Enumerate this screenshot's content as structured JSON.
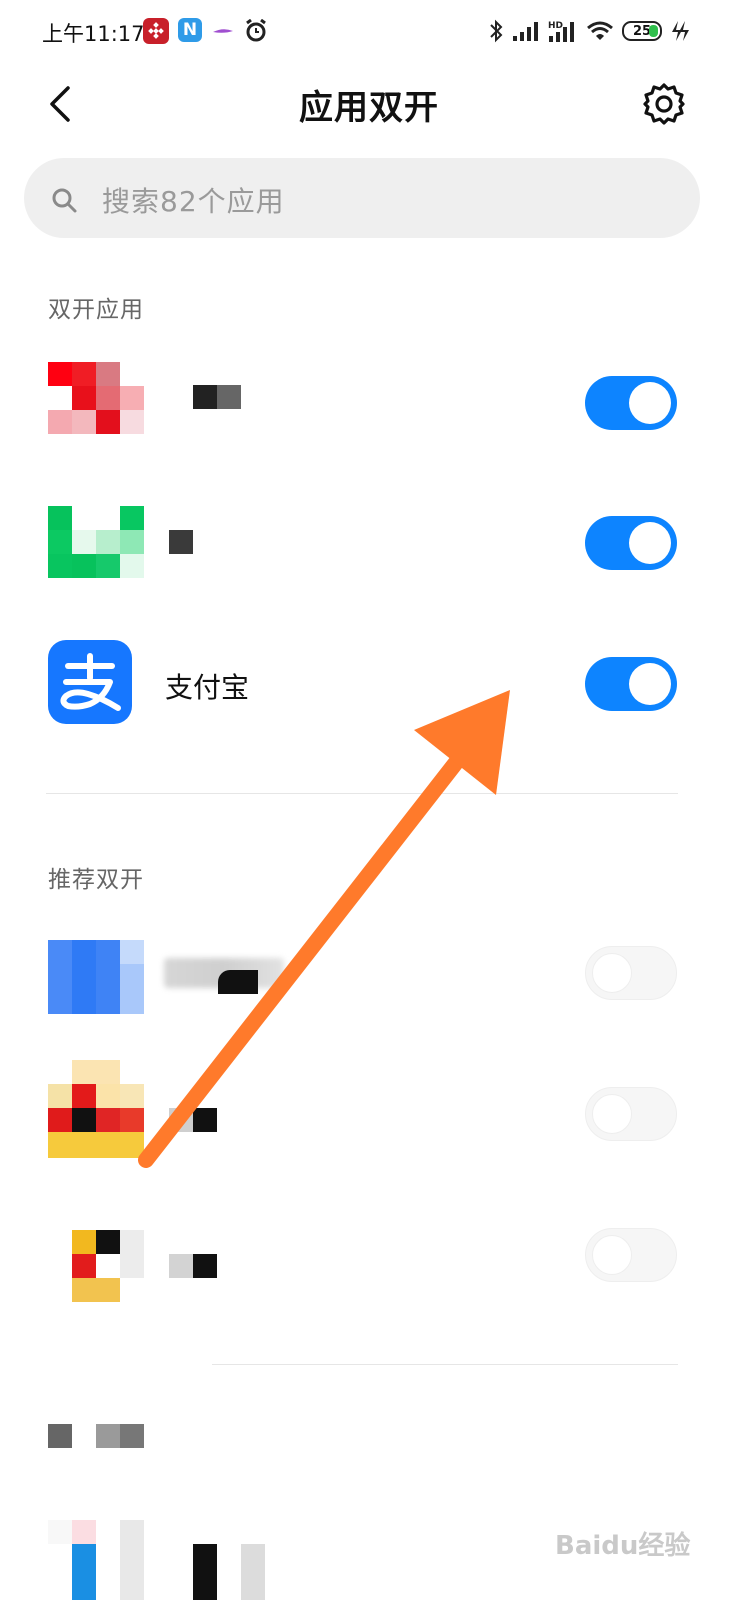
{
  "status_bar": {
    "time": "上午11:17",
    "battery": "25",
    "icons": [
      "app-badge-red-icon",
      "app-badge-n-icon",
      "feather-icon",
      "alarm-icon",
      "bluetooth-icon",
      "signal-icon",
      "hd-signal-icon",
      "wifi-icon",
      "battery-icon",
      "charging-icon"
    ]
  },
  "header": {
    "title": "应用双开"
  },
  "search": {
    "placeholder": "搜索82个应用"
  },
  "sections": {
    "dual": "双开应用",
    "recommended": "推荐双开"
  },
  "dual_apps": [
    {
      "name": "",
      "enabled": true
    },
    {
      "name": "",
      "enabled": true
    },
    {
      "name": "支付宝",
      "enabled": true
    }
  ],
  "recommended_apps": [
    {
      "name": "",
      "enabled": false
    },
    {
      "name": "",
      "enabled": false
    },
    {
      "name": "",
      "enabled": false
    }
  ],
  "watermark": "Baidu经验",
  "colors": {
    "accent": "#0d84ff",
    "arrow": "#ff7a2b",
    "alipay": "#1677ff"
  }
}
